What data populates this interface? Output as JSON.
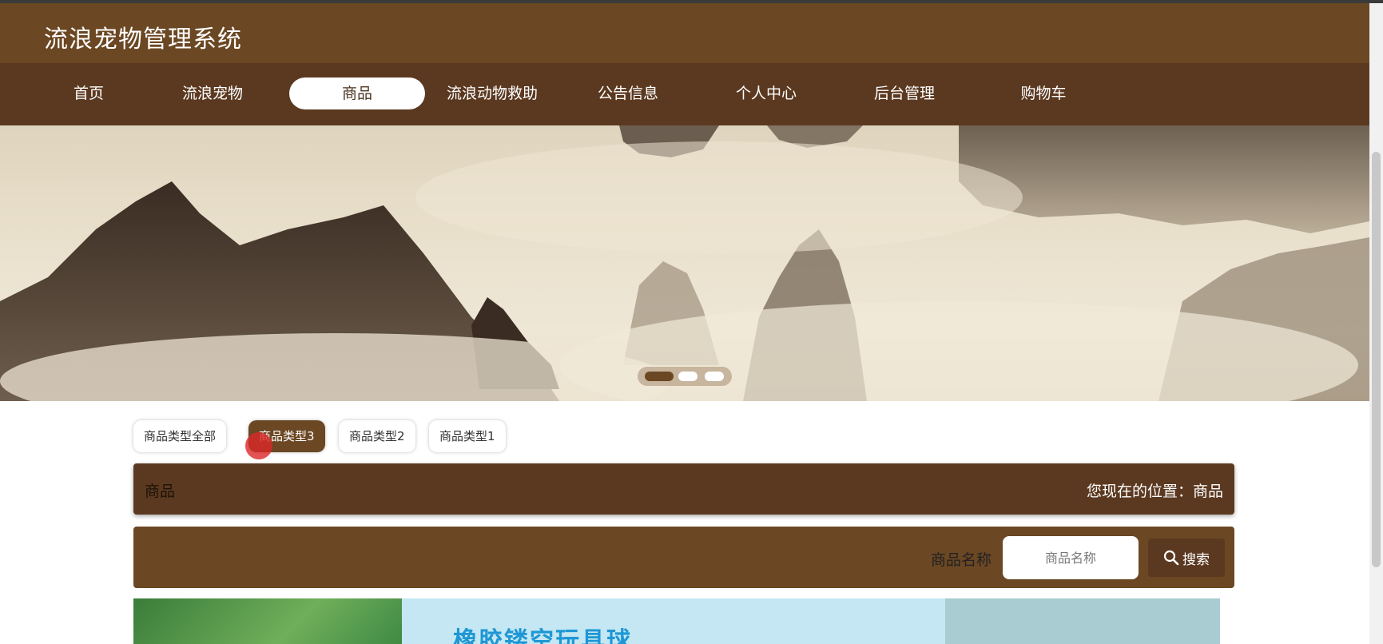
{
  "site": {
    "title": "流浪宠物管理系统"
  },
  "nav": {
    "items": [
      {
        "label": "首页"
      },
      {
        "label": "流浪宠物"
      },
      {
        "label": "商品",
        "active": true
      },
      {
        "label": "流浪动物救助"
      },
      {
        "label": "公告信息"
      },
      {
        "label": "个人中心"
      },
      {
        "label": "后台管理"
      },
      {
        "label": "购物车"
      }
    ]
  },
  "banner": {
    "slide_count": 3,
    "active_slide": 1,
    "loading_icon": "spinner-icon"
  },
  "categories": {
    "tabs": [
      {
        "label": "商品类型全部"
      },
      {
        "label": "商品类型3",
        "active": true
      },
      {
        "label": "商品类型2"
      },
      {
        "label": "商品类型1"
      }
    ]
  },
  "section": {
    "title": "商品",
    "breadcrumb": "您现在的位置：商品"
  },
  "search": {
    "label": "商品名称",
    "placeholder": "商品名称",
    "button_label": "搜索",
    "button_icon": "search-icon"
  },
  "products": [
    {
      "name": "橡胶镂空玩具球"
    }
  ],
  "colors": {
    "header": "#6b4723",
    "nav": "#5b3920",
    "accent": "#6b4723"
  }
}
